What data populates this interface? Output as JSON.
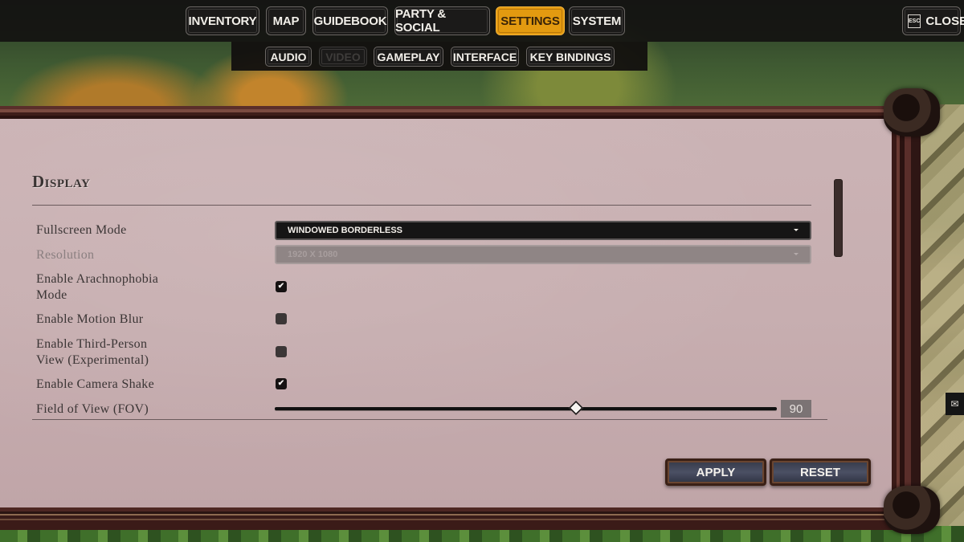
{
  "nav": {
    "tabs": [
      {
        "label": "INVENTORY",
        "active": false
      },
      {
        "label": "MAP",
        "active": false
      },
      {
        "label": "GUIDEBOOK",
        "active": false
      },
      {
        "label": "PARTY & SOCIAL",
        "active": false
      },
      {
        "label": "SETTINGS",
        "active": true
      },
      {
        "label": "SYSTEM",
        "active": false
      }
    ],
    "close": {
      "key": "ESC",
      "label": "CLOSE"
    }
  },
  "subnav": {
    "tabs": [
      {
        "label": "AUDIO",
        "disabled": false
      },
      {
        "label": "VIDEO",
        "disabled": true
      },
      {
        "label": "GAMEPLAY",
        "disabled": false
      },
      {
        "label": "INTERFACE",
        "disabled": false
      },
      {
        "label": "KEY BINDINGS",
        "disabled": false
      }
    ]
  },
  "section": {
    "title": "Display"
  },
  "settings": {
    "fullscreen_mode": {
      "label": "Fullscreen Mode",
      "value": "WINDOWED BORDERLESS"
    },
    "resolution": {
      "label": "Resolution",
      "value": "1920 X 1080",
      "disabled": true
    },
    "arachnophobia": {
      "label_line1": "Enable Arachnophobia",
      "label_line2": "Mode",
      "checked": true
    },
    "motion_blur": {
      "label": "Enable Motion Blur",
      "checked": false
    },
    "third_person": {
      "label_line1": "Enable Third-Person",
      "label_line2": "View (Experimental)",
      "checked": false
    },
    "camera_shake": {
      "label": "Enable Camera Shake",
      "checked": true
    },
    "fov": {
      "label": "Field of View (FOV)",
      "value": "90",
      "fraction": 0.6
    }
  },
  "actions": {
    "apply": "APPLY",
    "reset": "RESET"
  },
  "icons": {
    "checkmark": "✔",
    "side_tab": "✉"
  }
}
